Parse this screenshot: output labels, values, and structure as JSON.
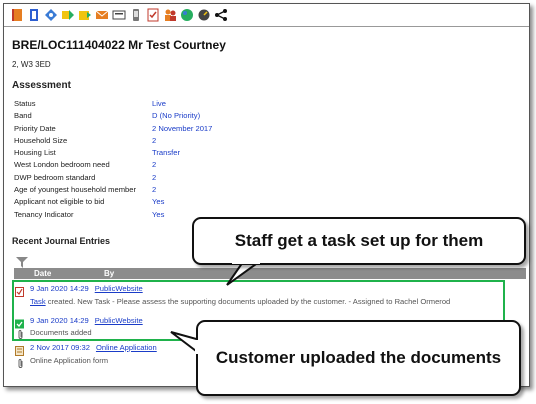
{
  "toolbar": {
    "icons": [
      "book-icon",
      "document-icon",
      "tag-icon",
      "arrow-right-icon",
      "folder-arrow-icon",
      "email-icon",
      "card-icon",
      "phone-icon",
      "checklist-icon",
      "people-icon",
      "globe-icon",
      "gauge-icon",
      "share-icon"
    ]
  },
  "record": {
    "title": "BRE/LOC111404022 Mr Test Courtney",
    "address": "2, W3 3ED"
  },
  "assessment": {
    "heading": "Assessment",
    "rows": [
      {
        "label": "Status",
        "value": "Live"
      },
      {
        "label": "Band",
        "value": "D (No Priority)"
      },
      {
        "label": "Priority Date",
        "value": "2 November 2017"
      },
      {
        "label": "Household Size",
        "value": "2"
      },
      {
        "label": "Housing List",
        "value": "Transfer"
      },
      {
        "label": "West London bedroom need",
        "value": "2"
      },
      {
        "label": "DWP bedroom standard",
        "value": "2"
      },
      {
        "label": "Age of youngest household member",
        "value": "2"
      },
      {
        "label": "Applicant not eligible to bid",
        "value": "Yes"
      },
      {
        "label": "Tenancy Indicator",
        "value": "Yes"
      }
    ]
  },
  "journal": {
    "heading": "Recent Journal Entries",
    "columns": {
      "date": "Date",
      "by": "By"
    },
    "entries": [
      {
        "date": "9 Jan 2020 14:29",
        "by": "PublicWebsite",
        "task_link": "Task",
        "description": " created. New Task - Please assess the supporting documents uploaded by the customer. - Assigned to Rachel Ormerod"
      },
      {
        "date": "9 Jan 2020 14:29",
        "by": "PublicWebsite",
        "description": "Documents added"
      },
      {
        "date": "2 Nov 2017 09:32",
        "by": "Online Application",
        "description": "Online Application form"
      }
    ]
  },
  "callouts": {
    "staff_task": "Staff get a task set up for them",
    "customer_upload": "Customer uploaded the documents"
  },
  "colors": {
    "link": "#1a3cc8",
    "highlight": "#1fb24b",
    "header": "#8c8c8c"
  }
}
